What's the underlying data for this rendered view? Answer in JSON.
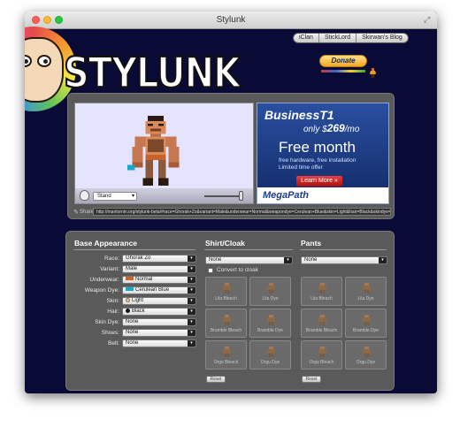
{
  "window": {
    "title": "Stylunk"
  },
  "logo": {
    "text": "STYLUNK"
  },
  "nav": {
    "links": [
      "iClan",
      "StickLord",
      "Skirwan's Blog"
    ]
  },
  "donate": {
    "label": "Donate"
  },
  "preview": {
    "pose": "Stand"
  },
  "ad": {
    "title": "BusinessT1",
    "price_prefix": "only $",
    "price_value": "269",
    "price_suffix": "/mo",
    "headline": "Free month",
    "sub_line1": "free hardware, free installation",
    "sub_line2": "Limited time offer",
    "button": "Learn More »",
    "brand": "MegaPath"
  },
  "share": {
    "label": "Share:",
    "url": "http://mantornin.org/stylunk-beta/#race=Ghorak+Zo&variant=Male&underwear=Normal&weapondye=Cerulean+Blue&skin=Light&hair=Black&skindye=None&shoes=None&belt=None&shirt=None&pants=None"
  },
  "base": {
    "title": "Base Appearance",
    "fields": [
      {
        "label": "Race:",
        "value": "Ghorak Zo"
      },
      {
        "label": "Variant:",
        "value": "Male"
      },
      {
        "label": "Underwear:",
        "value": "Normal"
      },
      {
        "label": "Weapon Dye:",
        "value": "Cerulean Blue"
      },
      {
        "label": "Skin:",
        "value": "Light"
      },
      {
        "label": "Hair:",
        "value": "Black"
      },
      {
        "label": "Skin Dye:",
        "value": "None"
      },
      {
        "label": "Shoes:",
        "value": "None"
      },
      {
        "label": "Belt:",
        "value": "None"
      }
    ],
    "colors": {
      "underwear": "#c9632a",
      "weapon_dye": "#18a7c4",
      "skin": "#e9c9a4",
      "hair": "#111111"
    }
  },
  "shirt": {
    "title": "Shirt/Cloak",
    "select": "None",
    "checkbox_label": "Convert to cloak",
    "tiles": [
      "Lila Bleach",
      "Lila Dye",
      "Bramble Bleach",
      "Bramble Dye",
      "Orgu Bleach",
      "Orgu Dye"
    ],
    "reset": "Reset"
  },
  "pants": {
    "title": "Pants",
    "select": "None",
    "tiles": [
      "Lila Bleach",
      "Lila Dye",
      "Bramble Bleach",
      "Bramble Dye",
      "Orgu Bleach",
      "Orgu Dye"
    ],
    "reset": "Reset"
  }
}
